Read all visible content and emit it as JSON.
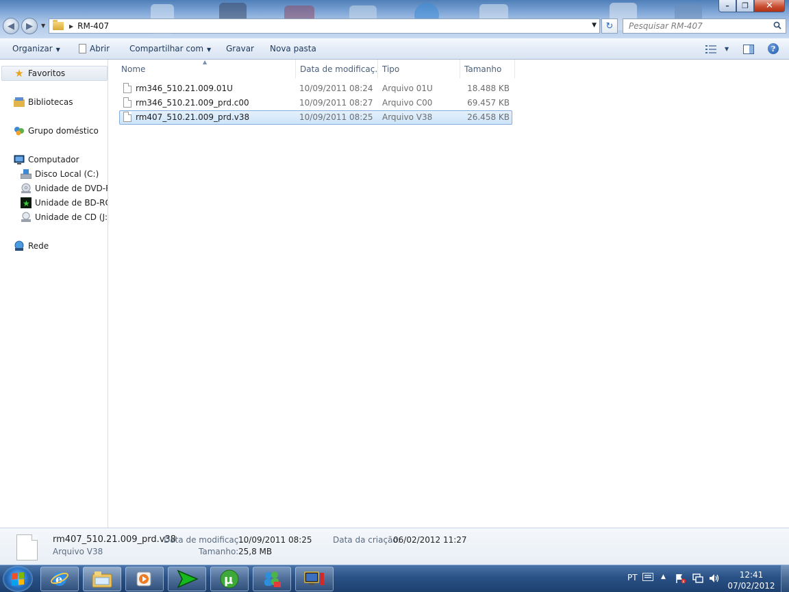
{
  "window": {
    "address": {
      "crumb": "RM-407"
    },
    "search": {
      "placeholder": "Pesquisar RM-407"
    }
  },
  "toolbar": {
    "organize": "Organizar",
    "open": "Abrir",
    "share": "Compartilhar com",
    "burn": "Gravar",
    "new_folder": "Nova pasta"
  },
  "sidebar": {
    "favorites": "Favoritos",
    "libraries": "Bibliotecas",
    "homegroup": "Grupo doméstico",
    "computer": "Computador",
    "drives": [
      {
        "label": "Disco Local (C:)"
      },
      {
        "label": "Unidade de DVD-RW"
      },
      {
        "label": "Unidade de BD-ROM"
      },
      {
        "label": "Unidade de CD (J:)"
      }
    ],
    "network": "Rede"
  },
  "columns": {
    "name": "Nome",
    "date": "Data de modificaç...",
    "type": "Tipo",
    "size": "Tamanho"
  },
  "files": [
    {
      "name": "rm346_510.21.009.01U",
      "date": "10/09/2011 08:24",
      "type": "Arquivo 01U",
      "size": "18.488 KB",
      "selected": false
    },
    {
      "name": "rm346_510.21.009_prd.c00",
      "date": "10/09/2011 08:27",
      "type": "Arquivo C00",
      "size": "69.457 KB",
      "selected": false
    },
    {
      "name": "rm407_510.21.009_prd.v38",
      "date": "10/09/2011 08:25",
      "type": "Arquivo V38",
      "size": "26.458 KB",
      "selected": true
    }
  ],
  "details": {
    "filename": "rm407_510.21.009_prd.v38",
    "filetype": "Arquivo V38",
    "modified_label": "Data de modificaç...",
    "modified_value": "10/09/2011 08:25",
    "size_label": "Tamanho:",
    "size_value": "25,8 MB",
    "created_label": "Data da criação:",
    "created_value": "06/02/2012 11:27"
  },
  "taskbar": {
    "language": "PT",
    "time": "12:41",
    "date": "07/02/2012"
  }
}
